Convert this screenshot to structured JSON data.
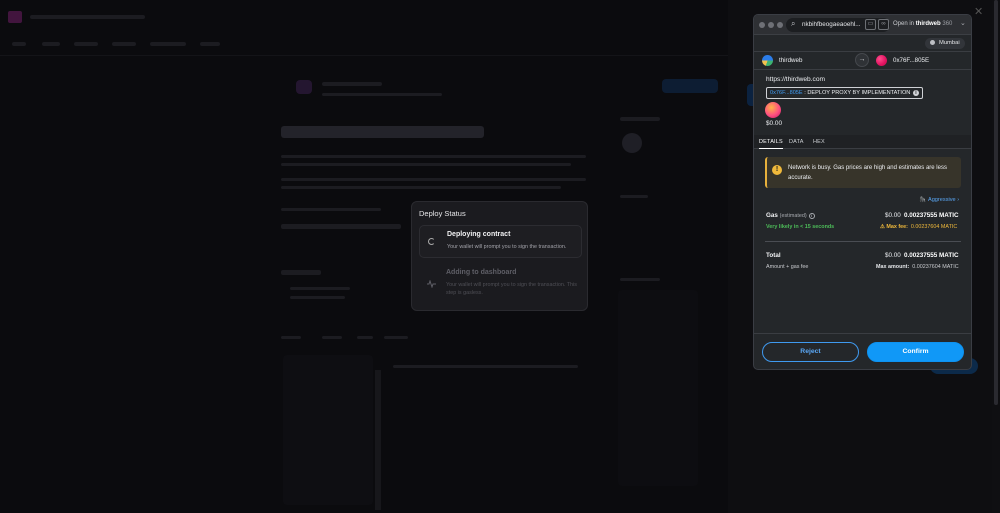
{
  "deploy_modal": {
    "title": "Deploy Status",
    "steps": [
      {
        "title": "Deploying contract",
        "description": "Your wallet will prompt you to sign the transaction."
      },
      {
        "title": "Adding to dashboard",
        "description": "Your wallet will prompt you to sign the transaction. This step is gasless."
      }
    ]
  },
  "wallet": {
    "browser": {
      "url": "nkbihfbeogaeaoehl...",
      "open_in_prefix": "Open in",
      "open_in_brand": "thirdweb",
      "open_in_suffix": "360"
    },
    "network": "Mumbai",
    "from_account": "thirdweb",
    "to_account": "0x76F...805E",
    "origin": "https://thirdweb.com",
    "method": {
      "address": "0x76F...805E",
      "separator": ":",
      "name": "DEPLOY PROXY BY IMPLEMENTATION",
      "info_icon": "i"
    },
    "value": "$0.00",
    "tabs": [
      "DETAILS",
      "DATA",
      "HEX"
    ],
    "active_tab": "DETAILS",
    "alert": {
      "icon": "!",
      "text": "Network is busy. Gas prices are high and estimates are less accurate."
    },
    "gas_speed": {
      "icon": "🦍",
      "label": "Aggressive",
      "chevron": "›"
    },
    "gas": {
      "label": "Gas",
      "estimated": "(estimated)",
      "info": "i",
      "fiat": "$0.00",
      "crypto": "0.00237555 MATIC",
      "likely": "Very likely in < 15 seconds",
      "max_fee_label": "⚠ Max fee:",
      "max_fee_value": "0.00237604 MATIC"
    },
    "total": {
      "label": "Total",
      "fiat": "$0.00",
      "crypto": "0.00237555 MATIC",
      "subtitle": "Amount + gas fee",
      "max_amount_label": "Max amount:",
      "max_amount_value": "0.00237604 MATIC"
    },
    "buttons": {
      "reject": "Reject",
      "confirm": "Confirm"
    }
  },
  "colors": {
    "accent_blue": "#1098f7",
    "warning_yellow": "#f0b93b",
    "success_green": "#4dbd59"
  }
}
